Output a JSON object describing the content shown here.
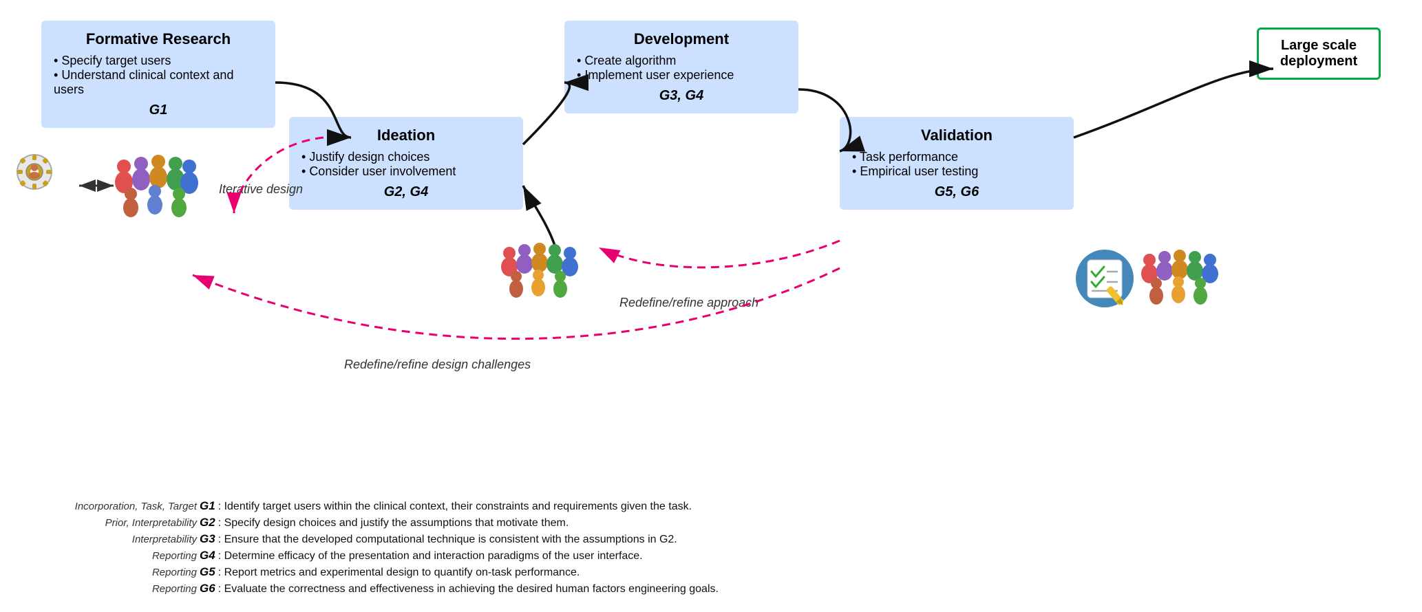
{
  "boxes": {
    "formative": {
      "title": "Formative Research",
      "bullets": [
        "Specify target users",
        "Understand clinical context and users"
      ],
      "goal": "G1",
      "id": "box-formative"
    },
    "development": {
      "title": "Development",
      "bullets": [
        "Create algorithm",
        "Implement user experience"
      ],
      "goal": "G3, G4",
      "id": "box-development"
    },
    "ideation": {
      "title": "Ideation",
      "bullets": [
        "Justify design choices",
        "Consider user involvement"
      ],
      "goal": "G2, G4",
      "id": "box-ideation"
    },
    "validation": {
      "title": "Validation",
      "bullets": [
        "Task performance",
        "Empirical user testing"
      ],
      "goal": "G5, G6",
      "id": "box-validation"
    },
    "deployment": {
      "title": "Large scale deployment",
      "id": "box-deployment"
    }
  },
  "labels": {
    "iterative_design": "Iterative design",
    "redefine_approach": "Redefine/refine approach",
    "redefine_design": "Redefine/refine design challenges"
  },
  "legend": [
    {
      "italic": "Incorporation, Task, Target",
      "g": "G1",
      "desc": ": Identify target users within the clinical context, their constraints and requirements given the task."
    },
    {
      "italic": "Prior, Interpretability",
      "g": "G2",
      "desc": ": Specify design choices and justify the assumptions that motivate them."
    },
    {
      "italic": "Interpretability",
      "g": "G3",
      "desc": ": Ensure that the developed computational technique is consistent with the assumptions in G2."
    },
    {
      "italic": "Reporting",
      "g": "G4",
      "desc": ": Determine efficacy of the presentation and interaction paradigms of the user interface."
    },
    {
      "italic": "Reporting",
      "g": "G5",
      "desc": ": Report metrics and experimental design to quantify on-task performance."
    },
    {
      "italic": "Reporting",
      "g": "G6",
      "desc": ": Evaluate the correctness and effectiveness in achieving the desired human factors engineering goals."
    }
  ]
}
